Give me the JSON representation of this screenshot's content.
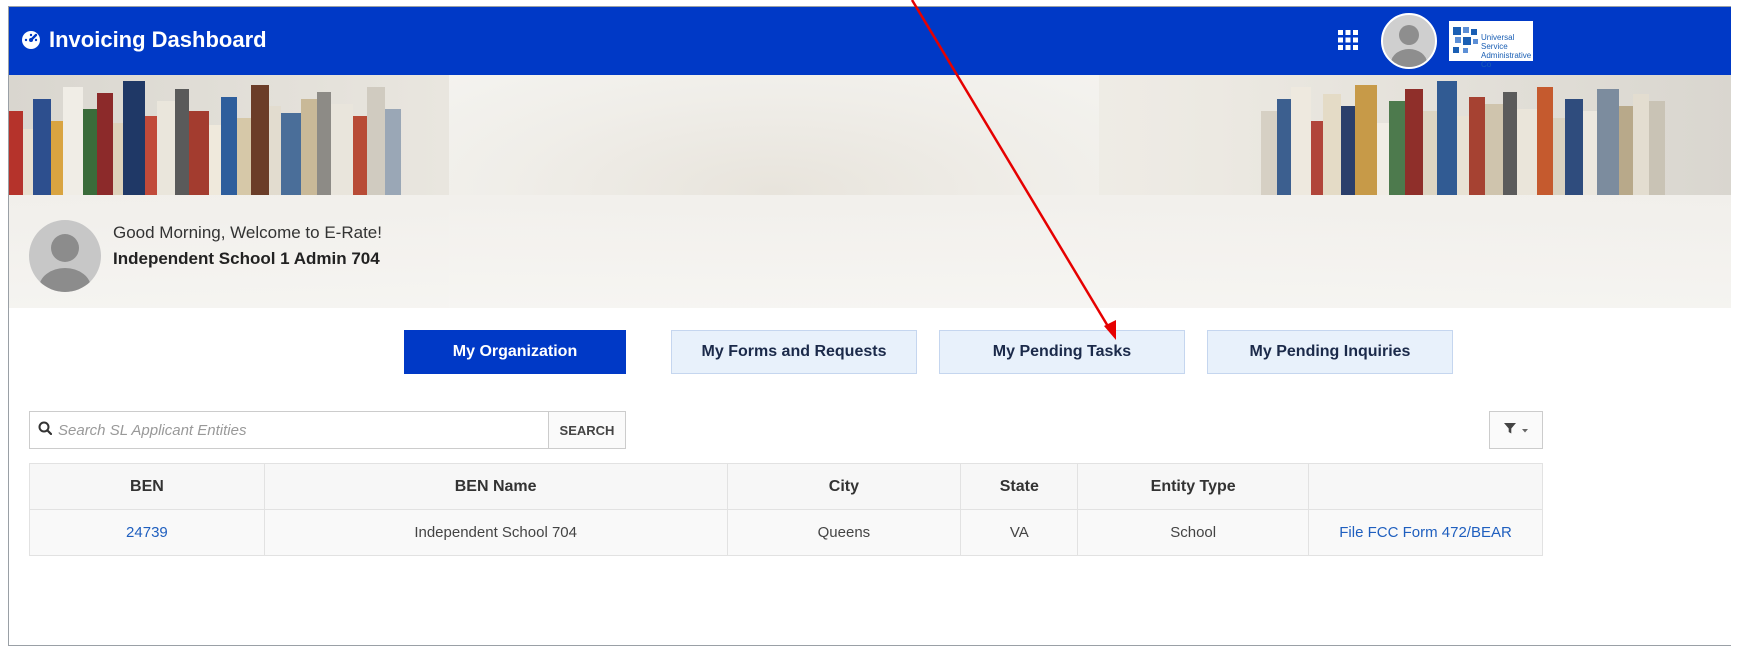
{
  "header": {
    "title": "Invoicing Dashboard",
    "logo_line1": "Universal Service",
    "logo_line2": "Administrative Co"
  },
  "welcome": {
    "greeting": "Good Morning, Welcome to E-Rate!",
    "organization": "Independent School 1 Admin 704"
  },
  "tabs": [
    {
      "label": "My Organization",
      "active": true
    },
    {
      "label": "My Forms and Requests",
      "active": false
    },
    {
      "label": "My Pending Tasks",
      "active": false
    },
    {
      "label": "My Pending Inquiries",
      "active": false
    }
  ],
  "search": {
    "placeholder": "Search SL Applicant Entities",
    "button_label": "SEARCH"
  },
  "table": {
    "columns": [
      "BEN",
      "BEN Name",
      "City",
      "State",
      "Entity Type",
      ""
    ],
    "rows": [
      [
        "24739",
        "Independent School 704",
        "Queens",
        "VA",
        "School",
        "File FCC Form 472/BEAR"
      ]
    ]
  },
  "colors": {
    "primary": "#0039c6",
    "tab_inactive": "#e8f1fb",
    "link": "#1f5fbf",
    "annotation_arrow": "#e60000"
  },
  "icons": {
    "title_icon": "dashboard-gauge-icon",
    "apps": "grid-icon",
    "search": "search-icon",
    "filter": "filter-icon"
  }
}
